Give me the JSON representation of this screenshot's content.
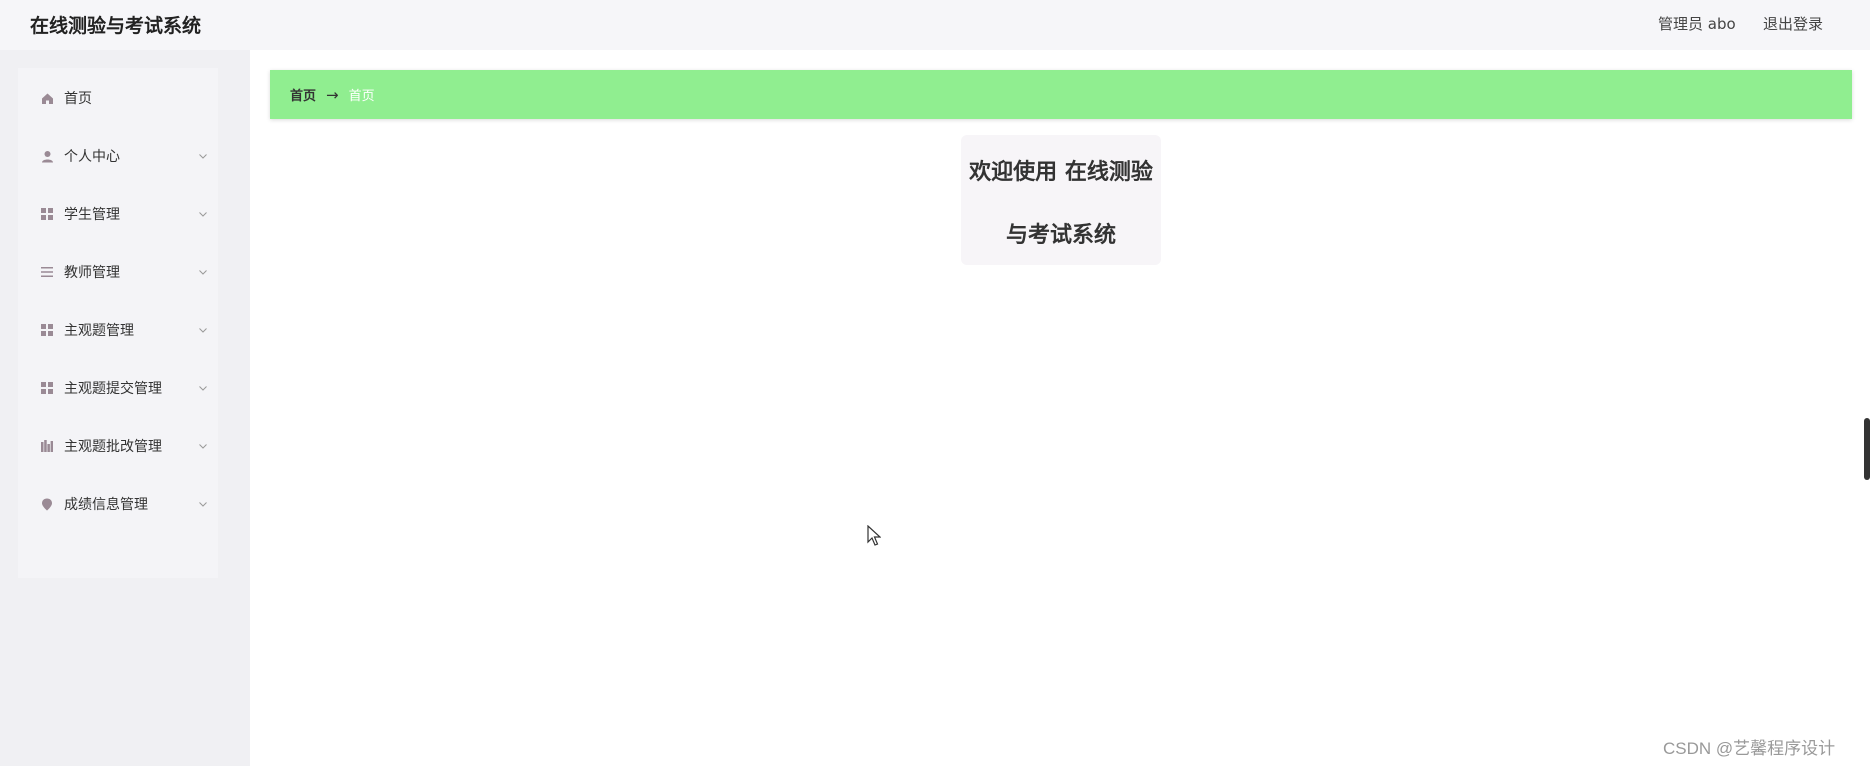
{
  "app": {
    "title": "在线测验与考试系统"
  },
  "header": {
    "user": "管理员 abo",
    "logout": "退出登录"
  },
  "sidebar": {
    "items": [
      {
        "label": "首页",
        "icon": "home-icon",
        "has_children": false
      },
      {
        "label": "个人中心",
        "icon": "user-icon",
        "has_children": true
      },
      {
        "label": "学生管理",
        "icon": "grid-icon",
        "has_children": true
      },
      {
        "label": "教师管理",
        "icon": "list-icon",
        "has_children": true
      },
      {
        "label": "主观题管理",
        "icon": "grid-icon",
        "has_children": true
      },
      {
        "label": "主观题提交管理",
        "icon": "grid-icon",
        "has_children": true
      },
      {
        "label": "主观题批改管理",
        "icon": "bar-chart-icon",
        "has_children": true
      },
      {
        "label": "成绩信息管理",
        "icon": "pin-icon",
        "has_children": true
      }
    ]
  },
  "breadcrumb": {
    "home": "首页",
    "separator": "→",
    "current": "首页"
  },
  "welcome": {
    "line1": "欢迎使用 在线测验",
    "line2": "与考试系统"
  },
  "watermark": "CSDN @艺馨程序设计",
  "colors": {
    "breadcrumb_bg": "#90ee90",
    "icon": "#9a8a95"
  }
}
